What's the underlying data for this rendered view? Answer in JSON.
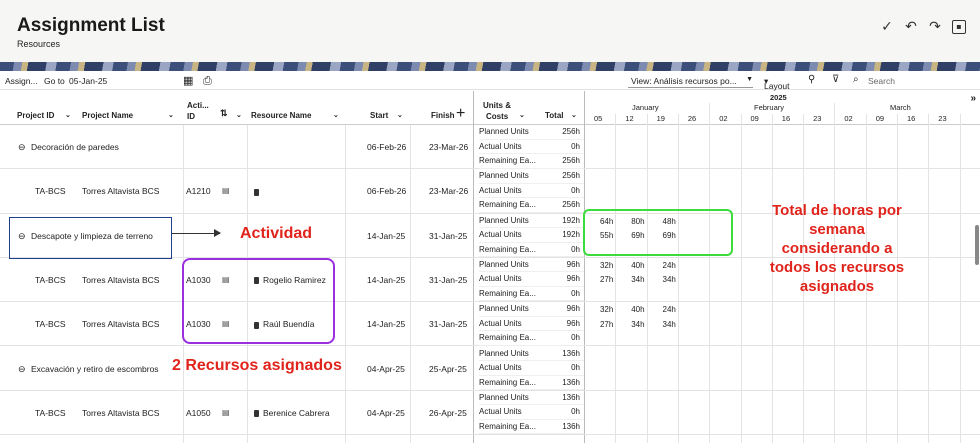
{
  "header": {
    "title": "Assignment List",
    "subtitle": "Resources"
  },
  "toolbar": {
    "assign_label": "Assign...",
    "goto_label": "Go to",
    "goto_date": "05-Jan-25",
    "view_label": "View: Análisis recursos po...",
    "layout_label": "Layout",
    "search_placeholder": "Search"
  },
  "columns": {
    "project_id": "Project ID",
    "project_name": "Project Name",
    "activity_id_1": "Acti...",
    "activity_id_2": "ID",
    "resource_name": "Resource Name",
    "start": "Start",
    "finish": "Finish",
    "units_costs_1": "Units &",
    "units_costs_2": "Costs",
    "total": "Total"
  },
  "timeline": {
    "year": "2025",
    "months": [
      "January",
      "February",
      "March"
    ],
    "weeks": [
      "05",
      "12",
      "19",
      "26",
      "02",
      "09",
      "16",
      "23",
      "02",
      "09",
      "16",
      "23"
    ]
  },
  "unit_labels": {
    "planned": "Planned Units",
    "actual": "Actual Units",
    "remaining": "Remaining Ea..."
  },
  "rows": [
    {
      "kind": "group",
      "name": "Decoración de paredes",
      "start": "06-Feb-26",
      "finish": "23-Mar-26",
      "planned": "256h",
      "actual": "0h",
      "remaining": "256h"
    },
    {
      "kind": "assign",
      "project_id": "TA-BCS",
      "project_name": "Torres Altavista BCS",
      "activity_id": "A1210",
      "resource": "",
      "start": "06-Feb-26",
      "finish": "23-Mar-26",
      "planned": "256h",
      "actual": "0h",
      "remaining": "256h"
    },
    {
      "kind": "group",
      "name": "Descapote y limpieza de terreno",
      "start": "14-Jan-25",
      "finish": "31-Jan-25",
      "planned": "192h",
      "actual": "192h",
      "remaining": "0h",
      "weekly_planned": [
        "64h",
        "80h",
        "48h"
      ],
      "weekly_actual": [
        "55h",
        "69h",
        "69h"
      ]
    },
    {
      "kind": "assign",
      "project_id": "TA-BCS",
      "project_name": "Torres Altavista BCS",
      "activity_id": "A1030",
      "resource": "Rogelio Ramirez",
      "start": "14-Jan-25",
      "finish": "31-Jan-25",
      "planned": "96h",
      "actual": "96h",
      "remaining": "0h",
      "weekly_planned": [
        "32h",
        "40h",
        "24h"
      ],
      "weekly_actual": [
        "27h",
        "34h",
        "34h"
      ]
    },
    {
      "kind": "assign",
      "project_id": "TA-BCS",
      "project_name": "Torres Altavista BCS",
      "activity_id": "A1030",
      "resource": "Raúl Buendía",
      "start": "14-Jan-25",
      "finish": "31-Jan-25",
      "planned": "96h",
      "actual": "96h",
      "remaining": "0h",
      "weekly_planned": [
        "32h",
        "40h",
        "24h"
      ],
      "weekly_actual": [
        "27h",
        "34h",
        "34h"
      ]
    },
    {
      "kind": "group",
      "name": "Excavación y retiro de escombros",
      "start": "04-Apr-25",
      "finish": "25-Apr-25",
      "planned": "136h",
      "actual": "0h",
      "remaining": "136h"
    },
    {
      "kind": "assign",
      "project_id": "TA-BCS",
      "project_name": "Torres Altavista BCS",
      "activity_id": "A1050",
      "resource": "Berenice Cabrera",
      "start": "04-Apr-25",
      "finish": "26-Apr-25",
      "planned": "136h",
      "actual": "0h",
      "remaining": "136h"
    }
  ],
  "annotations": {
    "actividad": "Actividad",
    "recursos": "2 Recursos asignados",
    "total_horas": [
      "Total de horas por",
      "semana",
      "considerando a",
      "todos los recursos",
      "asignados"
    ],
    "colors": {
      "text": "#e0241c",
      "blue_box": "#1f3e8c",
      "purple_box": "#9a2fe0",
      "green_box": "#3cdc3c"
    }
  }
}
